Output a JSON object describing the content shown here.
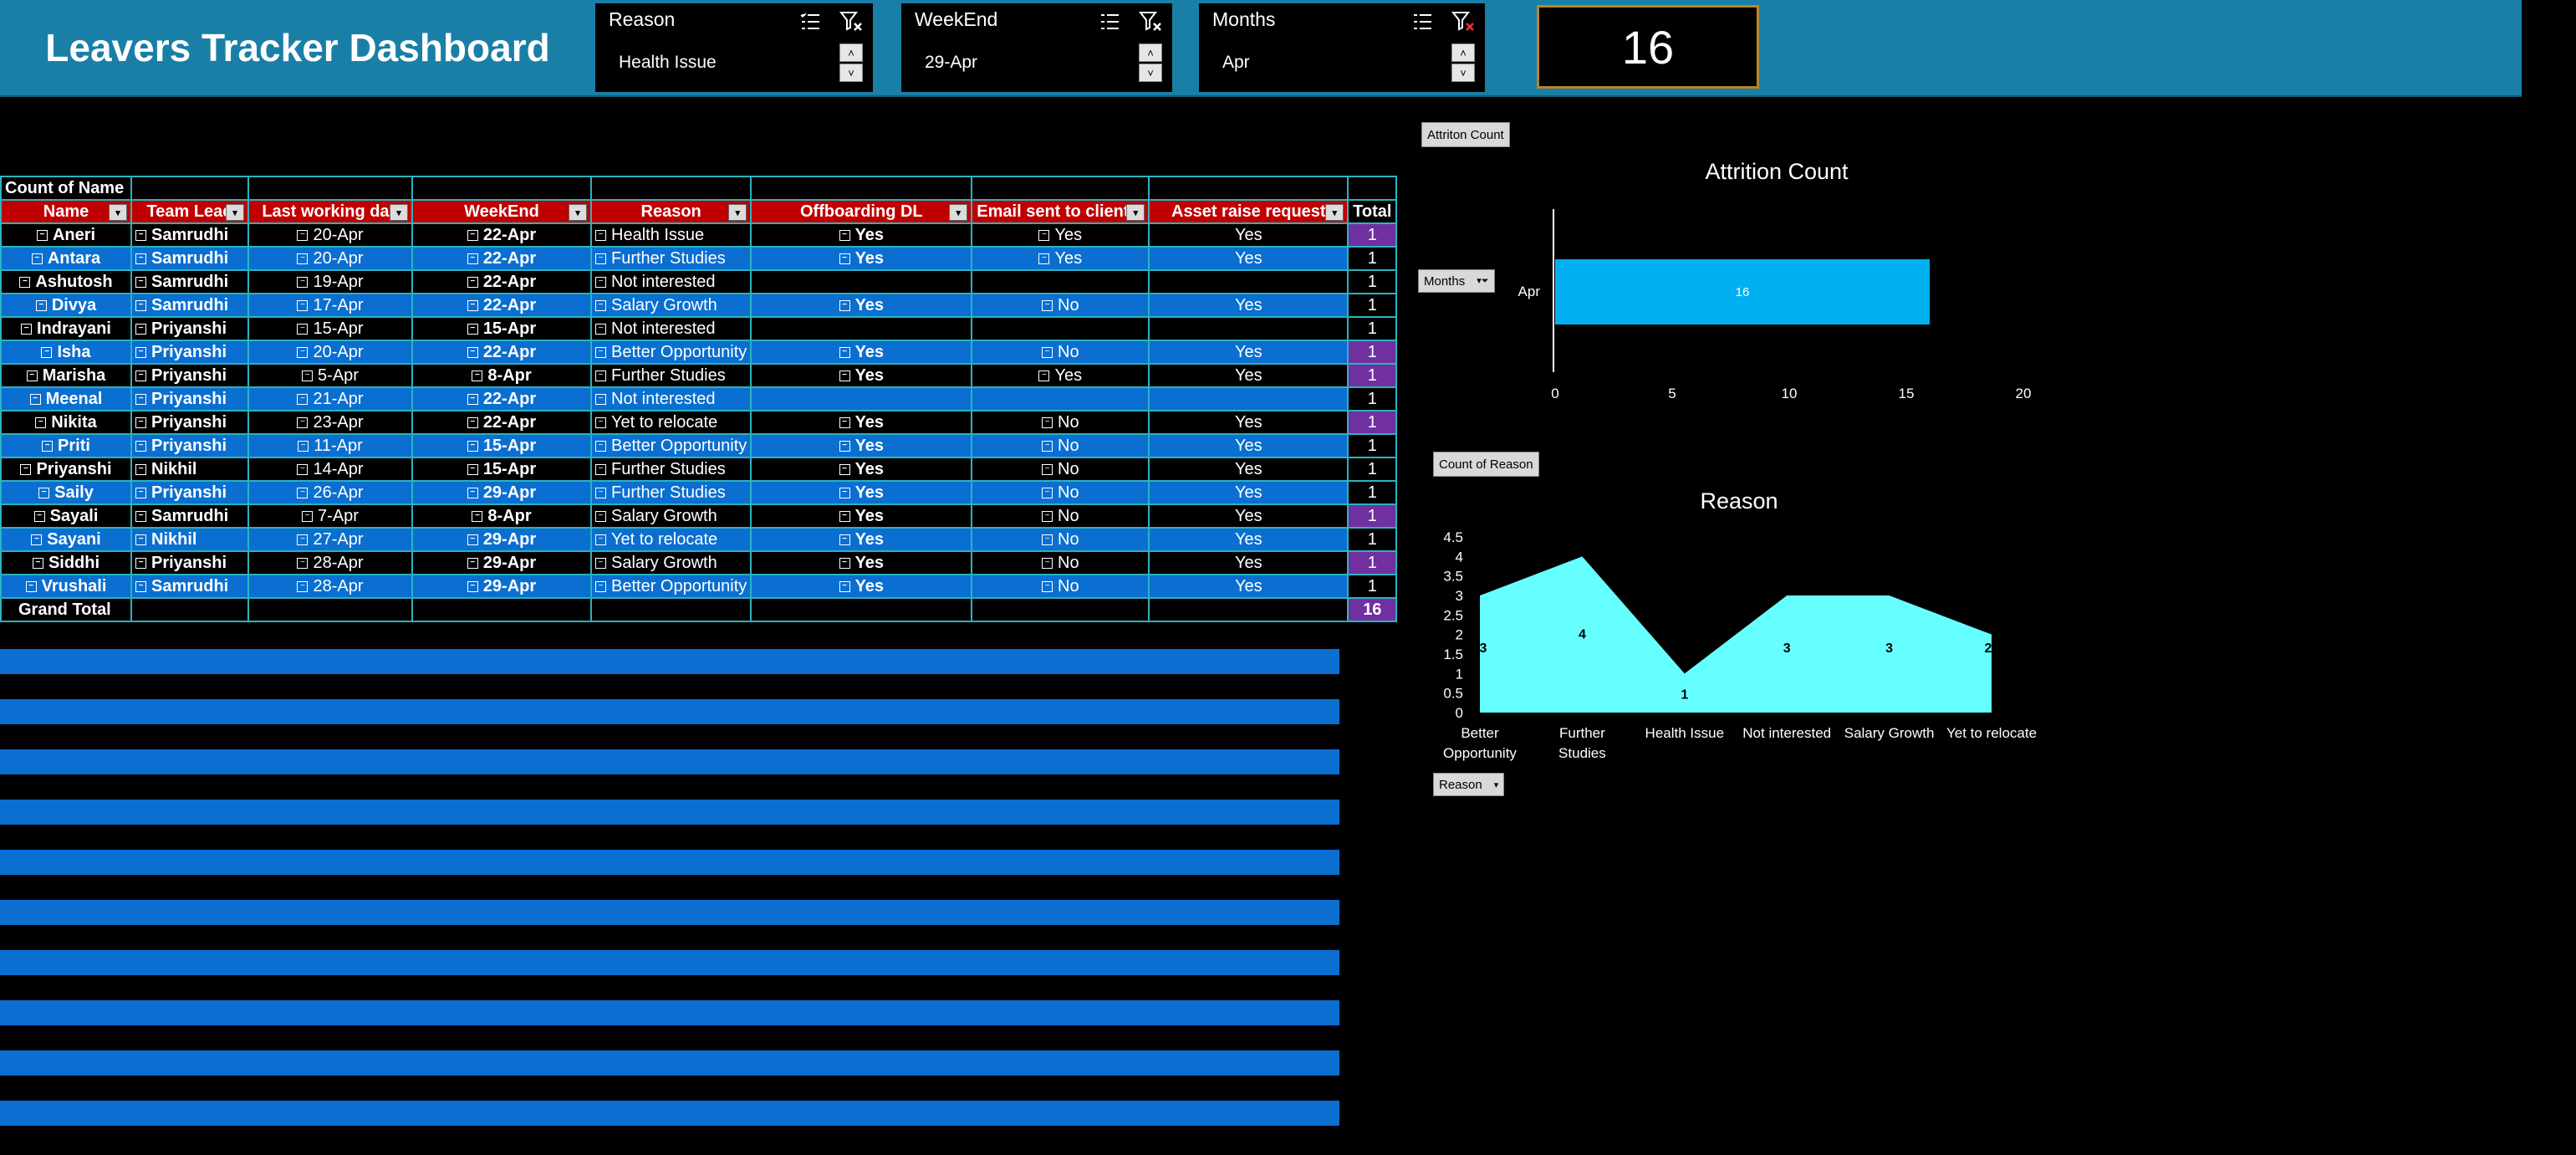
{
  "header": {
    "title": "Leavers Tracker Dashboard",
    "kpi_value": "16"
  },
  "slicers": [
    {
      "title": "Reason",
      "selected": "Health Issue"
    },
    {
      "title": "WeekEnd",
      "selected": "29-Apr"
    },
    {
      "title": "Months",
      "selected": "Apr"
    }
  ],
  "pivot": {
    "label": "Count of Name",
    "headers": [
      "Name",
      "Team Lead",
      "Last working day",
      "WeekEnd",
      "Reason",
      "Offboarding DL",
      "Email sent to client o",
      "Asset raise request",
      "Total"
    ],
    "rows": [
      {
        "name": "Aneri",
        "lead": "Samrudhi",
        "lwd": "20-Apr",
        "weekend": "22-Apr",
        "reason": "Health Issue",
        "dl": "Yes",
        "email": "Yes",
        "asset": "Yes",
        "total": "1",
        "hl": true
      },
      {
        "name": "Antara",
        "lead": "Samrudhi",
        "lwd": "20-Apr",
        "weekend": "22-Apr",
        "reason": "Further Studies",
        "dl": "Yes",
        "email": "Yes",
        "asset": "Yes",
        "total": "1",
        "hl": false
      },
      {
        "name": "Ashutosh",
        "lead": "Samrudhi",
        "lwd": "19-Apr",
        "weekend": "22-Apr",
        "reason": "Not interested",
        "dl": "",
        "email": "",
        "asset": "",
        "total": "1",
        "hl": false
      },
      {
        "name": "Divya",
        "lead": "Samrudhi",
        "lwd": "17-Apr",
        "weekend": "22-Apr",
        "reason": "Salary Growth",
        "dl": "Yes",
        "email": "No",
        "asset": "Yes",
        "total": "1",
        "hl": false
      },
      {
        "name": "Indrayani",
        "lead": "Priyanshi",
        "lwd": "15-Apr",
        "weekend": "15-Apr",
        "reason": "Not interested",
        "dl": "",
        "email": "",
        "asset": "",
        "total": "1",
        "hl": false
      },
      {
        "name": "Isha",
        "lead": "Priyanshi",
        "lwd": "20-Apr",
        "weekend": "22-Apr",
        "reason": "Better Opportunity",
        "dl": "Yes",
        "email": "No",
        "asset": "Yes",
        "total": "1",
        "hl": true
      },
      {
        "name": "Marisha",
        "lead": "Priyanshi",
        "lwd": "5-Apr",
        "weekend": "8-Apr",
        "reason": "Further Studies",
        "dl": "Yes",
        "email": "Yes",
        "asset": "Yes",
        "total": "1",
        "hl": true
      },
      {
        "name": "Meenal",
        "lead": "Priyanshi",
        "lwd": "21-Apr",
        "weekend": "22-Apr",
        "reason": "Not interested",
        "dl": "",
        "email": "",
        "asset": "",
        "total": "1",
        "hl": false
      },
      {
        "name": "Nikita",
        "lead": "Priyanshi",
        "lwd": "23-Apr",
        "weekend": "22-Apr",
        "reason": "Yet to relocate",
        "dl": "Yes",
        "email": "No",
        "asset": "Yes",
        "total": "1",
        "hl": true
      },
      {
        "name": "Priti",
        "lead": "Priyanshi",
        "lwd": "11-Apr",
        "weekend": "15-Apr",
        "reason": "Better Opportunity",
        "dl": "Yes",
        "email": "No",
        "asset": "Yes",
        "total": "1",
        "hl": false
      },
      {
        "name": "Priyanshi",
        "lead": "Nikhil",
        "lwd": "14-Apr",
        "weekend": "15-Apr",
        "reason": "Further Studies",
        "dl": "Yes",
        "email": "No",
        "asset": "Yes",
        "total": "1",
        "hl": false
      },
      {
        "name": "Saily",
        "lead": "Priyanshi",
        "lwd": "26-Apr",
        "weekend": "29-Apr",
        "reason": "Further Studies",
        "dl": "Yes",
        "email": "No",
        "asset": "Yes",
        "total": "1",
        "hl": false
      },
      {
        "name": "Sayali",
        "lead": "Samrudhi",
        "lwd": "7-Apr",
        "weekend": "8-Apr",
        "reason": "Salary Growth",
        "dl": "Yes",
        "email": "No",
        "asset": "Yes",
        "total": "1",
        "hl": true
      },
      {
        "name": "Sayani",
        "lead": "Nikhil",
        "lwd": "27-Apr",
        "weekend": "29-Apr",
        "reason": "Yet to relocate",
        "dl": "Yes",
        "email": "No",
        "asset": "Yes",
        "total": "1",
        "hl": false
      },
      {
        "name": "Siddhi",
        "lead": "Priyanshi",
        "lwd": "28-Apr",
        "weekend": "29-Apr",
        "reason": "Salary Growth",
        "dl": "Yes",
        "email": "No",
        "asset": "Yes",
        "total": "1",
        "hl": true
      },
      {
        "name": "Vrushali",
        "lead": "Samrudhi",
        "lwd": "28-Apr",
        "weekend": "29-Apr",
        "reason": "Better Opportunity",
        "dl": "Yes",
        "email": "No",
        "asset": "Yes",
        "total": "1",
        "hl": false
      }
    ],
    "grand_total_label": "Grand Total",
    "grand_total_value": "16"
  },
  "chart_buttons": {
    "attrition": "Attriton Count",
    "months": "Months",
    "reason_count": "Count of Reason",
    "reason": "Reason"
  },
  "chart_data": [
    {
      "type": "bar",
      "orientation": "horizontal",
      "title": "Attrition Count",
      "categories": [
        "Apr"
      ],
      "values": [
        16
      ],
      "xlim": [
        0,
        20
      ],
      "xticks": [
        "0",
        "5",
        "10",
        "15",
        "20"
      ],
      "data_labels": [
        "16"
      ],
      "color": "#00b0f0"
    },
    {
      "type": "area",
      "title": "Reason",
      "categories": [
        "Better Opportunity",
        "Further Studies",
        "Health Issue",
        "Not interested",
        "Salary Growth",
        "Yet to relocate"
      ],
      "values": [
        3,
        4,
        1,
        3,
        3,
        2
      ],
      "ylim": [
        0,
        4.5
      ],
      "yticks": [
        "0",
        "0.5",
        "1",
        "1.5",
        "2",
        "2.5",
        "3",
        "3.5",
        "4",
        "4.5"
      ],
      "color": "#66ffff"
    }
  ]
}
